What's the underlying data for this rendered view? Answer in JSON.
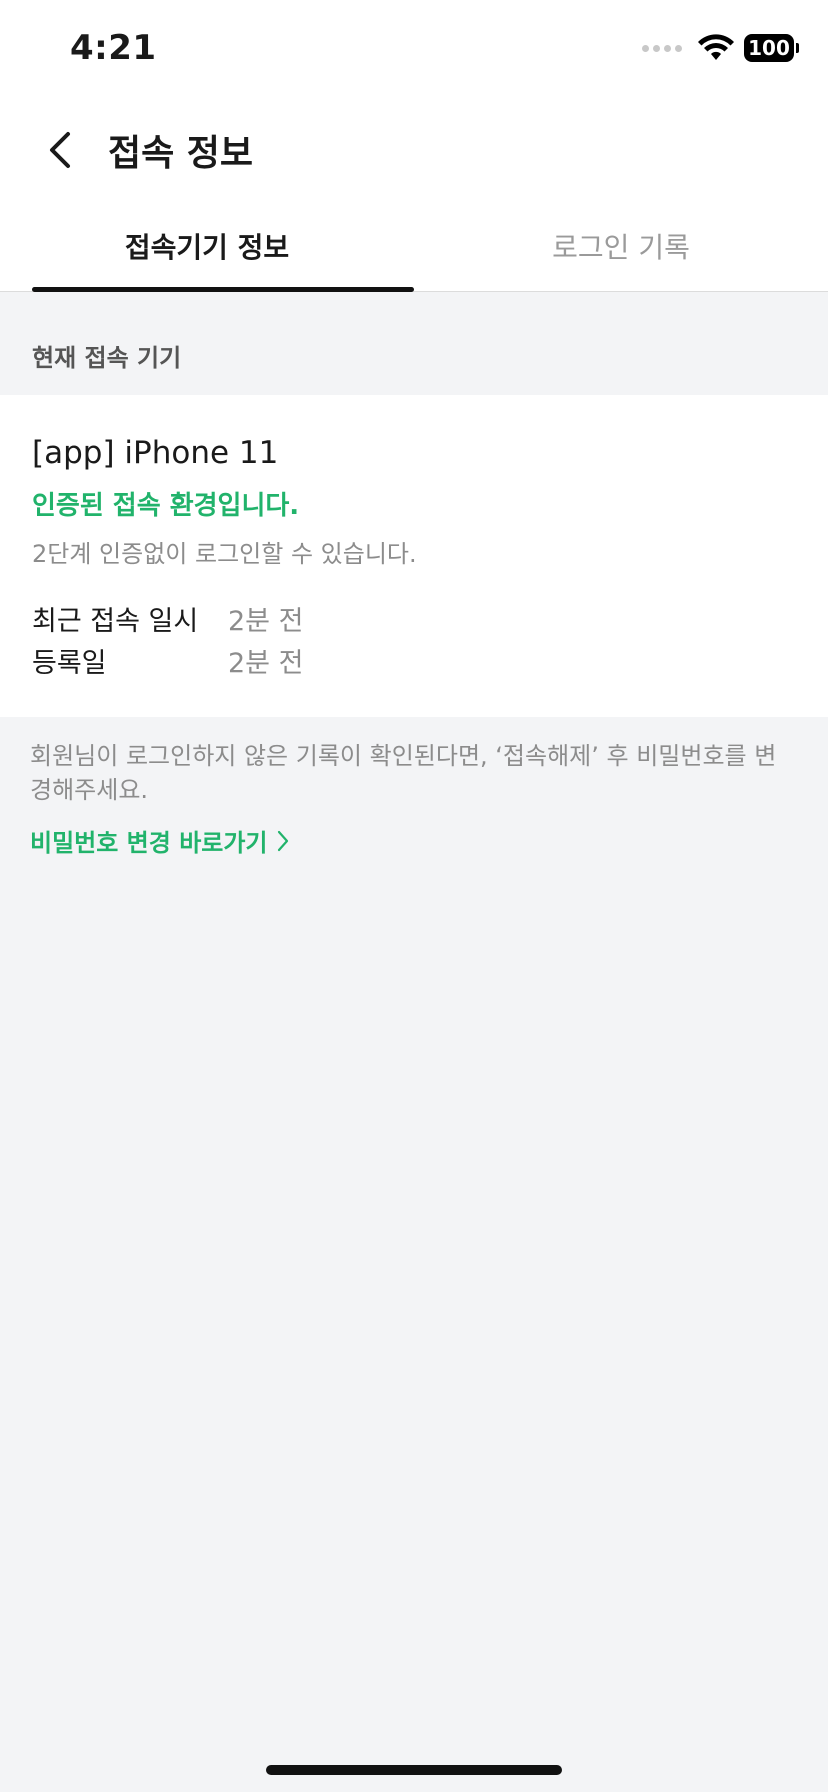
{
  "status_bar": {
    "time": "4:21",
    "battery": "100"
  },
  "nav": {
    "title": "접속 정보"
  },
  "tabs": [
    {
      "label": "접속기기 정보",
      "active": true
    },
    {
      "label": "로그인 기록",
      "active": false
    }
  ],
  "section": {
    "header": "현재 접속 기기"
  },
  "device": {
    "name": "[app] iPhone 11",
    "status": "인증된 접속 환경입니다.",
    "sub": "2단계 인증없이 로그인할 수 있습니다.",
    "rows": [
      {
        "label": "최근 접속 일시",
        "value": "2분 전"
      },
      {
        "label": "등록일",
        "value": "2분 전"
      }
    ]
  },
  "notice": {
    "text": "회원님이 로그인하지 않은 기록이 확인된다면, ‘접속해제’ 후 비밀번호를 변경해주세요.",
    "link": "비밀번호 변경 바로가기"
  },
  "colors": {
    "accent_green": "#21b36b",
    "background": "#f3f4f6"
  }
}
